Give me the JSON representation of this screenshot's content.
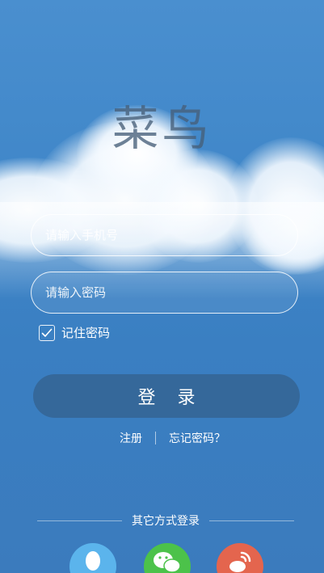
{
  "app": {
    "title": "菜鸟"
  },
  "login": {
    "phone_placeholder": "请输入手机号",
    "password_placeholder": "请输入密码",
    "remember_label": "记住密码",
    "remember_checked": true,
    "login_label": "登 录",
    "register_link": "注册",
    "forgot_link": "忘记密码？"
  },
  "other_login": {
    "label": "其它方式登录",
    "providers": [
      {
        "name": "qq-icon",
        "color": "#5bb4ec"
      },
      {
        "name": "wechat-icon",
        "color": "#4cc24a"
      },
      {
        "name": "weibo-icon",
        "color": "#e4654e"
      }
    ]
  },
  "colors": {
    "sky": "#3f86c8",
    "button": "#3b6690",
    "text": "#ffffff"
  }
}
